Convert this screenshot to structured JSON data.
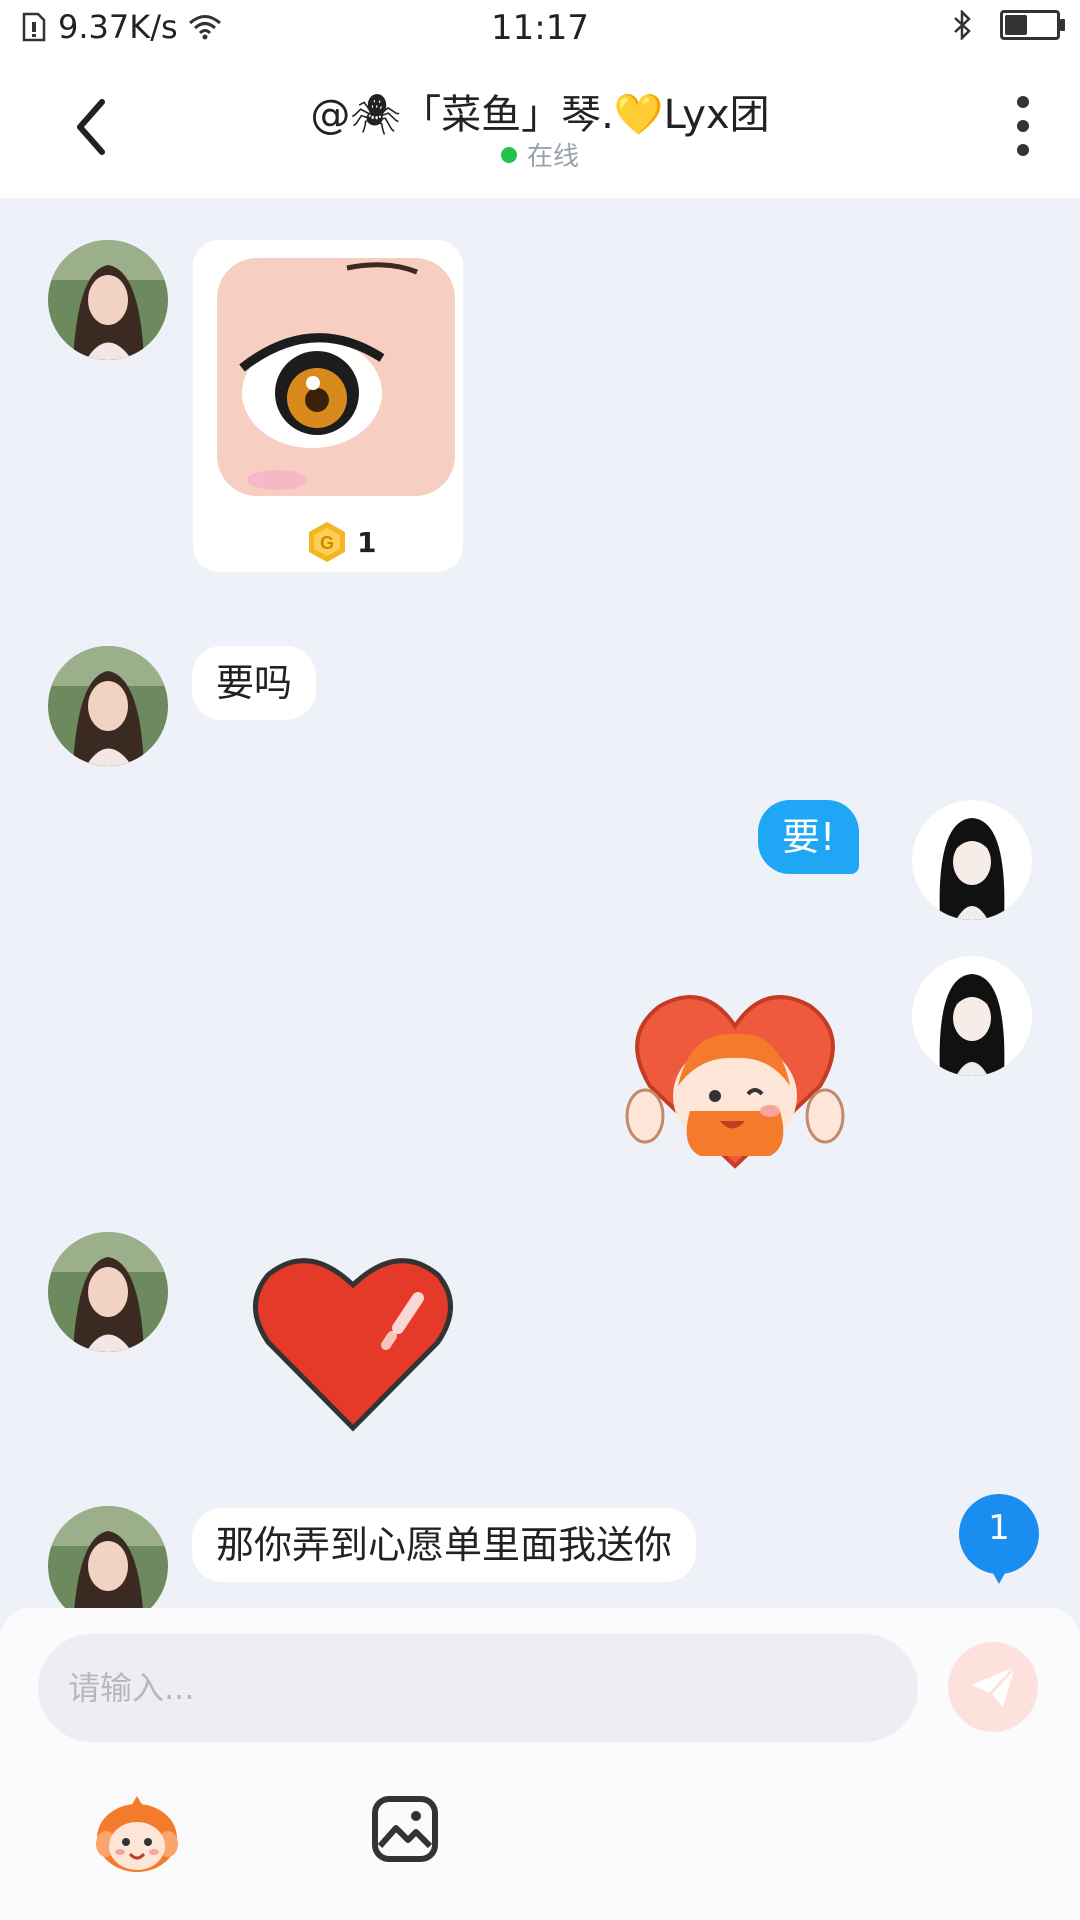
{
  "status_bar": {
    "net_speed": "9.37K/s",
    "time": "11:17",
    "battery_level": 0.45
  },
  "header": {
    "title": "@🕷「菜鱼」琴.💛Lyx团",
    "presence": "在线"
  },
  "messages": [
    {
      "side": "left",
      "kind": "gift",
      "coin_count": "1"
    },
    {
      "side": "left",
      "kind": "text",
      "text": "要吗"
    },
    {
      "side": "right",
      "kind": "text",
      "text": "要!"
    },
    {
      "side": "right",
      "kind": "sticker",
      "sticker": "heart-hug-sticker"
    },
    {
      "side": "left",
      "kind": "sticker",
      "sticker": "heart-sticker"
    },
    {
      "side": "left",
      "kind": "text",
      "text": "那你弄到心愿单里面我送你"
    }
  ],
  "unread_badge": "1",
  "composer": {
    "placeholder": "请输入..."
  },
  "colors": {
    "my_bubble": "#1fa7f5",
    "background": "#eef1f8",
    "send_button": "#fde1dd",
    "online": "#27c24c"
  }
}
